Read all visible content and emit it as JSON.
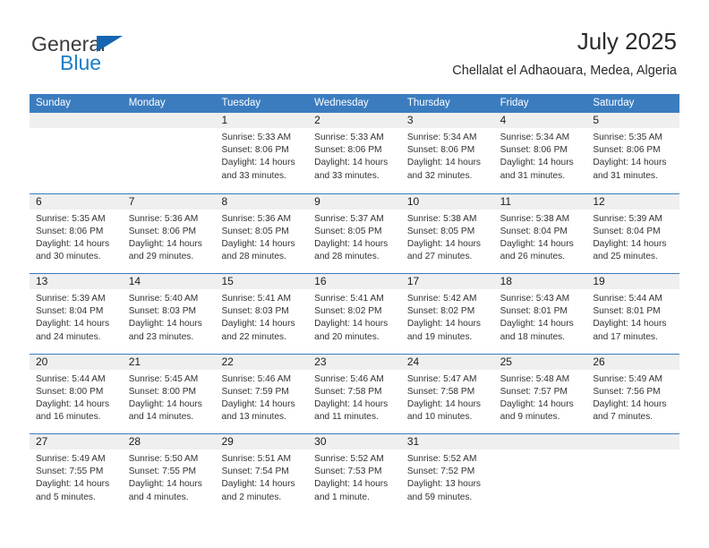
{
  "brand": {
    "name_top": "General",
    "name_bottom": "Blue",
    "triangle_color": "#1565b0",
    "blue_color": "#1a7ec8"
  },
  "header": {
    "title": "July 2025",
    "subtitle": "Chellalat el Adhaouara, Medea, Algeria",
    "accent_color": "#3b7cbf"
  },
  "weekdays": [
    "Sunday",
    "Monday",
    "Tuesday",
    "Wednesday",
    "Thursday",
    "Friday",
    "Saturday"
  ],
  "weeks": [
    [
      {
        "day": "",
        "sunrise": "",
        "sunset": "",
        "daylight1": "",
        "daylight2": ""
      },
      {
        "day": "",
        "sunrise": "",
        "sunset": "",
        "daylight1": "",
        "daylight2": ""
      },
      {
        "day": "1",
        "sunrise": "Sunrise: 5:33 AM",
        "sunset": "Sunset: 8:06 PM",
        "daylight1": "Daylight: 14 hours",
        "daylight2": "and 33 minutes."
      },
      {
        "day": "2",
        "sunrise": "Sunrise: 5:33 AM",
        "sunset": "Sunset: 8:06 PM",
        "daylight1": "Daylight: 14 hours",
        "daylight2": "and 33 minutes."
      },
      {
        "day": "3",
        "sunrise": "Sunrise: 5:34 AM",
        "sunset": "Sunset: 8:06 PM",
        "daylight1": "Daylight: 14 hours",
        "daylight2": "and 32 minutes."
      },
      {
        "day": "4",
        "sunrise": "Sunrise: 5:34 AM",
        "sunset": "Sunset: 8:06 PM",
        "daylight1": "Daylight: 14 hours",
        "daylight2": "and 31 minutes."
      },
      {
        "day": "5",
        "sunrise": "Sunrise: 5:35 AM",
        "sunset": "Sunset: 8:06 PM",
        "daylight1": "Daylight: 14 hours",
        "daylight2": "and 31 minutes."
      }
    ],
    [
      {
        "day": "6",
        "sunrise": "Sunrise: 5:35 AM",
        "sunset": "Sunset: 8:06 PM",
        "daylight1": "Daylight: 14 hours",
        "daylight2": "and 30 minutes."
      },
      {
        "day": "7",
        "sunrise": "Sunrise: 5:36 AM",
        "sunset": "Sunset: 8:06 PM",
        "daylight1": "Daylight: 14 hours",
        "daylight2": "and 29 minutes."
      },
      {
        "day": "8",
        "sunrise": "Sunrise: 5:36 AM",
        "sunset": "Sunset: 8:05 PM",
        "daylight1": "Daylight: 14 hours",
        "daylight2": "and 28 minutes."
      },
      {
        "day": "9",
        "sunrise": "Sunrise: 5:37 AM",
        "sunset": "Sunset: 8:05 PM",
        "daylight1": "Daylight: 14 hours",
        "daylight2": "and 28 minutes."
      },
      {
        "day": "10",
        "sunrise": "Sunrise: 5:38 AM",
        "sunset": "Sunset: 8:05 PM",
        "daylight1": "Daylight: 14 hours",
        "daylight2": "and 27 minutes."
      },
      {
        "day": "11",
        "sunrise": "Sunrise: 5:38 AM",
        "sunset": "Sunset: 8:04 PM",
        "daylight1": "Daylight: 14 hours",
        "daylight2": "and 26 minutes."
      },
      {
        "day": "12",
        "sunrise": "Sunrise: 5:39 AM",
        "sunset": "Sunset: 8:04 PM",
        "daylight1": "Daylight: 14 hours",
        "daylight2": "and 25 minutes."
      }
    ],
    [
      {
        "day": "13",
        "sunrise": "Sunrise: 5:39 AM",
        "sunset": "Sunset: 8:04 PM",
        "daylight1": "Daylight: 14 hours",
        "daylight2": "and 24 minutes."
      },
      {
        "day": "14",
        "sunrise": "Sunrise: 5:40 AM",
        "sunset": "Sunset: 8:03 PM",
        "daylight1": "Daylight: 14 hours",
        "daylight2": "and 23 minutes."
      },
      {
        "day": "15",
        "sunrise": "Sunrise: 5:41 AM",
        "sunset": "Sunset: 8:03 PM",
        "daylight1": "Daylight: 14 hours",
        "daylight2": "and 22 minutes."
      },
      {
        "day": "16",
        "sunrise": "Sunrise: 5:41 AM",
        "sunset": "Sunset: 8:02 PM",
        "daylight1": "Daylight: 14 hours",
        "daylight2": "and 20 minutes."
      },
      {
        "day": "17",
        "sunrise": "Sunrise: 5:42 AM",
        "sunset": "Sunset: 8:02 PM",
        "daylight1": "Daylight: 14 hours",
        "daylight2": "and 19 minutes."
      },
      {
        "day": "18",
        "sunrise": "Sunrise: 5:43 AM",
        "sunset": "Sunset: 8:01 PM",
        "daylight1": "Daylight: 14 hours",
        "daylight2": "and 18 minutes."
      },
      {
        "day": "19",
        "sunrise": "Sunrise: 5:44 AM",
        "sunset": "Sunset: 8:01 PM",
        "daylight1": "Daylight: 14 hours",
        "daylight2": "and 17 minutes."
      }
    ],
    [
      {
        "day": "20",
        "sunrise": "Sunrise: 5:44 AM",
        "sunset": "Sunset: 8:00 PM",
        "daylight1": "Daylight: 14 hours",
        "daylight2": "and 16 minutes."
      },
      {
        "day": "21",
        "sunrise": "Sunrise: 5:45 AM",
        "sunset": "Sunset: 8:00 PM",
        "daylight1": "Daylight: 14 hours",
        "daylight2": "and 14 minutes."
      },
      {
        "day": "22",
        "sunrise": "Sunrise: 5:46 AM",
        "sunset": "Sunset: 7:59 PM",
        "daylight1": "Daylight: 14 hours",
        "daylight2": "and 13 minutes."
      },
      {
        "day": "23",
        "sunrise": "Sunrise: 5:46 AM",
        "sunset": "Sunset: 7:58 PM",
        "daylight1": "Daylight: 14 hours",
        "daylight2": "and 11 minutes."
      },
      {
        "day": "24",
        "sunrise": "Sunrise: 5:47 AM",
        "sunset": "Sunset: 7:58 PM",
        "daylight1": "Daylight: 14 hours",
        "daylight2": "and 10 minutes."
      },
      {
        "day": "25",
        "sunrise": "Sunrise: 5:48 AM",
        "sunset": "Sunset: 7:57 PM",
        "daylight1": "Daylight: 14 hours",
        "daylight2": "and 9 minutes."
      },
      {
        "day": "26",
        "sunrise": "Sunrise: 5:49 AM",
        "sunset": "Sunset: 7:56 PM",
        "daylight1": "Daylight: 14 hours",
        "daylight2": "and 7 minutes."
      }
    ],
    [
      {
        "day": "27",
        "sunrise": "Sunrise: 5:49 AM",
        "sunset": "Sunset: 7:55 PM",
        "daylight1": "Daylight: 14 hours",
        "daylight2": "and 5 minutes."
      },
      {
        "day": "28",
        "sunrise": "Sunrise: 5:50 AM",
        "sunset": "Sunset: 7:55 PM",
        "daylight1": "Daylight: 14 hours",
        "daylight2": "and 4 minutes."
      },
      {
        "day": "29",
        "sunrise": "Sunrise: 5:51 AM",
        "sunset": "Sunset: 7:54 PM",
        "daylight1": "Daylight: 14 hours",
        "daylight2": "and 2 minutes."
      },
      {
        "day": "30",
        "sunrise": "Sunrise: 5:52 AM",
        "sunset": "Sunset: 7:53 PM",
        "daylight1": "Daylight: 14 hours",
        "daylight2": "and 1 minute."
      },
      {
        "day": "31",
        "sunrise": "Sunrise: 5:52 AM",
        "sunset": "Sunset: 7:52 PM",
        "daylight1": "Daylight: 13 hours",
        "daylight2": "and 59 minutes."
      },
      {
        "day": "",
        "sunrise": "",
        "sunset": "",
        "daylight1": "",
        "daylight2": ""
      },
      {
        "day": "",
        "sunrise": "",
        "sunset": "",
        "daylight1": "",
        "daylight2": ""
      }
    ]
  ]
}
